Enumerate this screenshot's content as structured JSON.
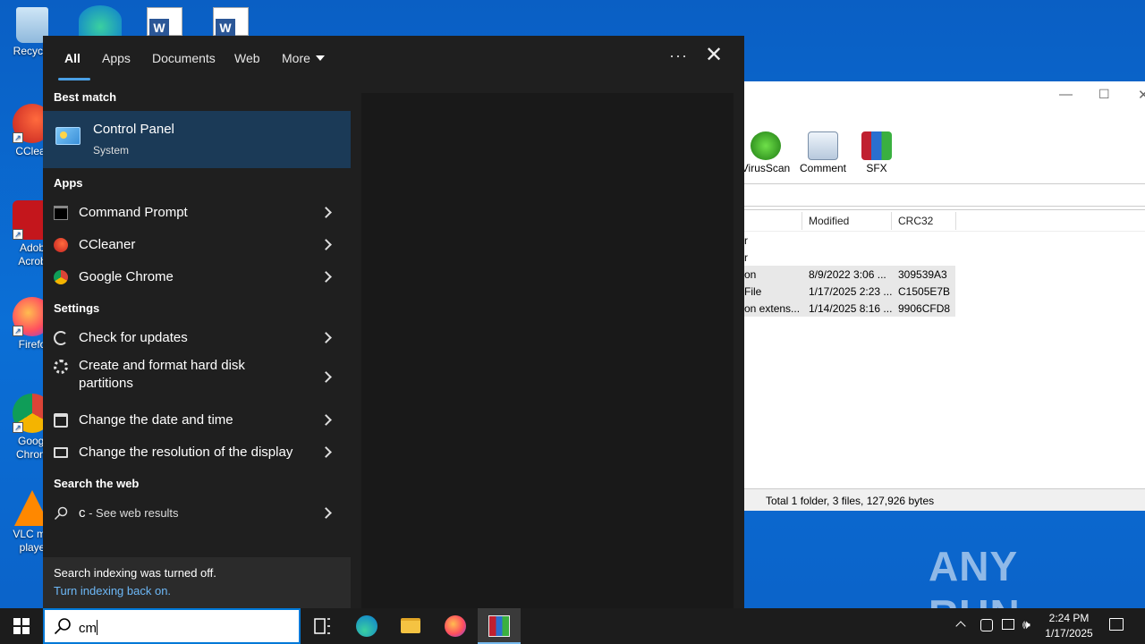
{
  "desktop": {
    "icons": [
      {
        "label": "Recycle"
      },
      {
        "label": "CClear"
      },
      {
        "label": "Adob\nAcrob"
      },
      {
        "label": "Firefo"
      },
      {
        "label": "Googl\nChrom"
      },
      {
        "label": "VLC me\nplaye"
      }
    ]
  },
  "winrar": {
    "toolbar": [
      {
        "label": "VirusScan",
        "icon": "virusscan-icon"
      },
      {
        "label": "Comment",
        "icon": "comment-icon"
      },
      {
        "label": "SFX",
        "icon": "sfx-icon"
      }
    ],
    "columns": {
      "modified": "Modified",
      "crc": "CRC32"
    },
    "rows": [
      {
        "type": "r",
        "modified": "",
        "crc": ""
      },
      {
        "type": "r",
        "modified": "",
        "crc": ""
      },
      {
        "type": "on",
        "modified": "8/9/2022 3:06 ...",
        "crc": "309539A3"
      },
      {
        "type": "File",
        "modified": "1/17/2025 2:23 ...",
        "crc": "C1505E7B"
      },
      {
        "type": "on extens...",
        "modified": "1/14/2025 8:16 ...",
        "crc": "9906CFD8"
      }
    ],
    "status": "Total 1 folder, 3 files, 127,926 bytes"
  },
  "watermark": "ANY RUN",
  "search": {
    "tabs": {
      "all": "All",
      "apps": "Apps",
      "documents": "Documents",
      "web": "Web",
      "more": "More"
    },
    "best_match_heading": "Best match",
    "best_match": {
      "title": "Control Panel",
      "subtitle": "System"
    },
    "apps_heading": "Apps",
    "apps": [
      {
        "label": "Command Prompt"
      },
      {
        "label": "CCleaner"
      },
      {
        "label": "Google Chrome"
      }
    ],
    "settings_heading": "Settings",
    "settings": [
      {
        "label": "Check for updates"
      },
      {
        "label": "Create and format hard disk partitions"
      },
      {
        "label": "Change the date and time"
      },
      {
        "label": "Change the resolution of the display"
      }
    ],
    "web_heading": "Search the web",
    "web_item": {
      "query": "c",
      "suffix": " - See web results"
    },
    "indexing": {
      "message": "Search indexing was turned off.",
      "link": "Turn indexing back on."
    }
  },
  "taskbar": {
    "search_text": "cm",
    "time": "2:24 PM",
    "date": "1/17/2025"
  }
}
